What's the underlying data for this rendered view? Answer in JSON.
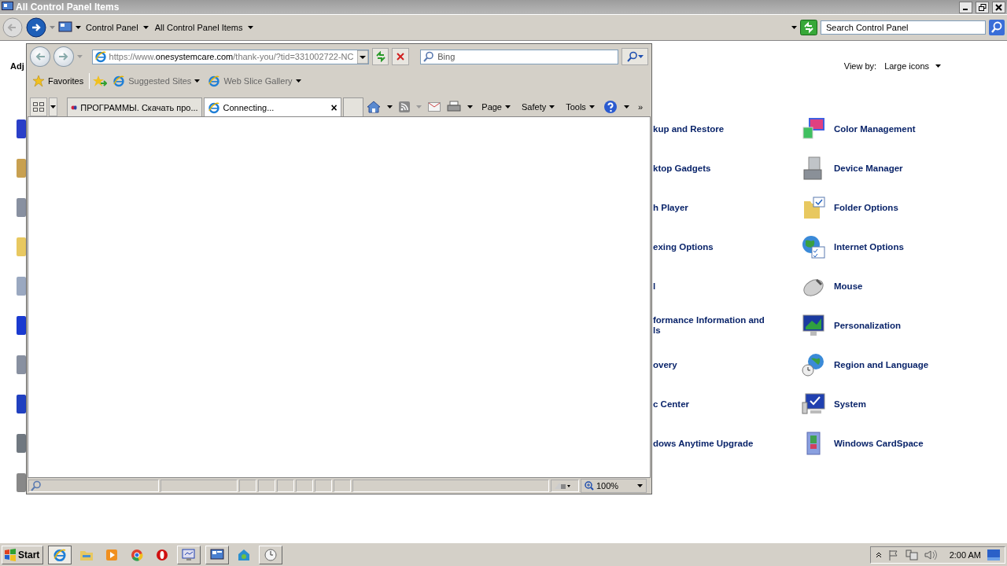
{
  "control_panel": {
    "title": "All Control Panel Items",
    "breadcrumbs": [
      "Control Panel",
      "All Control Panel Items"
    ],
    "search": {
      "placeholder": "Search Control Panel"
    },
    "heading": "Adj",
    "view_by": {
      "label": "View by:",
      "value": "Large icons"
    },
    "middle_items": [
      "kup and Restore",
      "ktop Gadgets",
      "h Player",
      "exing Options",
      "l",
      "formance Information and\nls",
      "overy",
      "c Center",
      "dows Anytime Upgrade"
    ],
    "right_items": [
      {
        "label": "Color Management",
        "kind": "color"
      },
      {
        "label": "Device Manager",
        "kind": "device"
      },
      {
        "label": "Folder Options",
        "kind": "folder"
      },
      {
        "label": "Internet Options",
        "kind": "internet"
      },
      {
        "label": "Mouse",
        "kind": "mouse"
      },
      {
        "label": "Personalization",
        "kind": "personalization"
      },
      {
        "label": "Region and Language",
        "kind": "region"
      },
      {
        "label": "System",
        "kind": "system"
      },
      {
        "label": "Windows CardSpace",
        "kind": "cardspace"
      }
    ]
  },
  "browser": {
    "url": {
      "prefix": "https://www.",
      "domain": "onesystemcare.com",
      "suffix": "/thank-you/?tid=331002722-NC"
    },
    "search": {
      "placeholder": "Bing"
    },
    "favorites": "Favorites",
    "links": [
      "Suggested Sites",
      "Web Slice Gallery"
    ],
    "tabs": [
      {
        "label": "ПРОГРАММЫ. Скачать про...",
        "kind": "sd",
        "selected": false
      },
      {
        "label": "Connecting...",
        "kind": "ie",
        "selected": true,
        "close": "×"
      }
    ],
    "commands": [
      "Page",
      "Safety",
      "Tools"
    ],
    "more": "»",
    "zoom": "100%"
  },
  "taskbar": {
    "start": "Start",
    "time": "2:00 AM",
    "apps": [
      {
        "kind": "ie",
        "active": true,
        "running": true
      },
      {
        "kind": "explorer",
        "active": false,
        "running": false
      },
      {
        "kind": "media",
        "active": false,
        "running": false
      },
      {
        "kind": "chrome",
        "active": false,
        "running": false
      },
      {
        "kind": "opera",
        "active": false,
        "running": false
      },
      {
        "kind": "remote",
        "active": false,
        "running": true
      },
      {
        "kind": "panel",
        "active": false,
        "running": true
      },
      {
        "kind": "home",
        "active": false,
        "running": false
      },
      {
        "kind": "clock",
        "active": false,
        "running": true
      }
    ]
  }
}
